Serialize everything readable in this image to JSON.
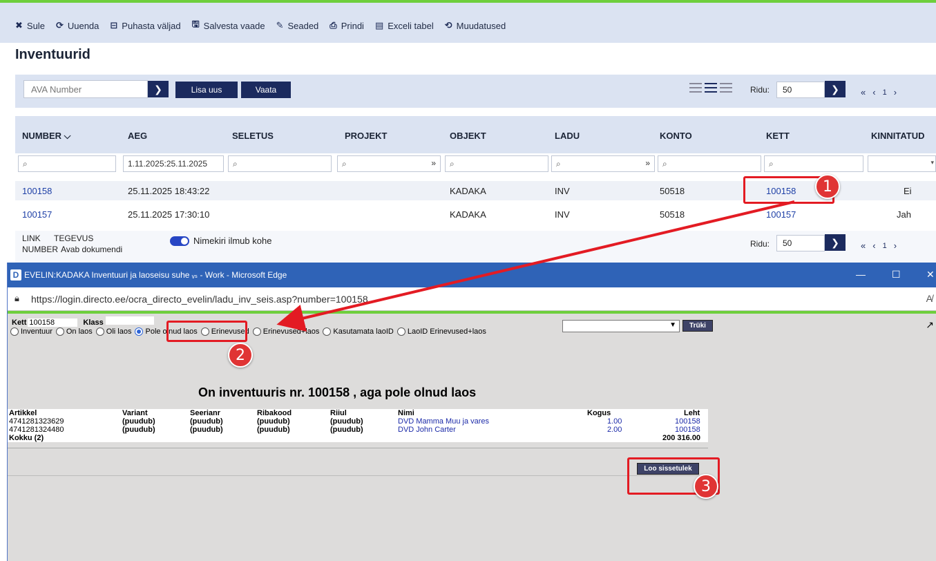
{
  "toolbar": {
    "items": [
      {
        "icon": "✖",
        "label": "Sule"
      },
      {
        "icon": "⟳",
        "label": "Uuenda"
      },
      {
        "icon": "⊟",
        "label": "Puhasta väljad"
      },
      {
        "icon": "🖫",
        "label": "Salvesta vaade"
      },
      {
        "icon": "✎",
        "label": "Seaded"
      },
      {
        "icon": "⎙",
        "label": "Prindi"
      },
      {
        "icon": "▤",
        "label": "Exceli tabel"
      },
      {
        "icon": "⟲",
        "label": "Muudatused"
      }
    ]
  },
  "page": {
    "title": "Inventuurid"
  },
  "actions": {
    "ava_placeholder": "AVA Number",
    "lisa_uus": "Lisa uus",
    "vaata": "Vaata",
    "ridu_label": "Ridu:",
    "ridu_value": "50",
    "page_number": "1"
  },
  "grid": {
    "columns": [
      "NUMBER ⌵",
      "AEG",
      "SELETUS",
      "PROJEKT",
      "OBJEKT",
      "LADU",
      "KONTO",
      "KETT",
      "KINNITATUD"
    ],
    "date_filter": "1.11.2025:25.11.2025",
    "rows": [
      {
        "number": "100158",
        "aeg": "25.11.2025 18:43:22",
        "objekt": "KADAKA",
        "ladu": "INV",
        "konto": "50518",
        "kett": "100158",
        "kinnitatud": "Ei"
      },
      {
        "number": "100157",
        "aeg": "25.11.2025 17:30:10",
        "objekt": "KADAKA",
        "ladu": "INV",
        "konto": "50518",
        "kett": "100157",
        "kinnitatud": "Jah"
      }
    ]
  },
  "legend": {
    "link": "LINK",
    "tegevus": "TEGEVUS",
    "number": "NUMBER",
    "avab": "Avab dokumendi",
    "toggle_label": "Nimekiri ilmub kohe",
    "ridu_label": "Ridu:",
    "ridu_value": "50",
    "page_number": "1"
  },
  "edge": {
    "title": "EVELIN:KADAKA Inventuuri ja laoseisu suhe ᵥₛ - Work - Microsoft Edge",
    "url": "https://login.directo.ee/ocra_directo_evelin/ladu_inv_seis.asp?number=100158",
    "minimize": "—",
    "maximize": "☐",
    "close": "✕"
  },
  "report": {
    "kett_label": "Kett",
    "kett_value": "100158",
    "klass_label": "Klass",
    "radios": [
      "Inventuur",
      "On laos",
      "Oli laos",
      "Pole olnud laos",
      "Erinevused",
      "Erinevused+laos",
      "Kasutamata laoID",
      "LaoID Erinevused+laos"
    ],
    "selected_radio": "Pole olnud laos",
    "truki": "Trüki",
    "heading": "On inventuuris nr. 100158 , aga pole olnud laos",
    "columns": [
      "Artikkel",
      "Variant",
      "Seerianr",
      "Ribakood",
      "Riiul",
      "Nimi",
      "Kogus",
      "Leht"
    ],
    "rows": [
      {
        "artikkel": "4741281323629",
        "variant": "(puudub)",
        "seerianr": "(puudub)",
        "ribakood": "(puudub)",
        "riiul": "(puudub)",
        "nimi": "DVD Mamma Muu ja vares",
        "kogus": "1.00",
        "leht": "100158"
      },
      {
        "artikkel": "4741281324480",
        "variant": "(puudub)",
        "seerianr": "(puudub)",
        "ribakood": "(puudub)",
        "riiul": "(puudub)",
        "nimi": "DVD John Carter",
        "kogus": "2.00",
        "leht": "100158"
      }
    ],
    "total_label": "Kokku (2)",
    "total_value": "200 316.00",
    "loo_sissetulek": "Loo sissetulek"
  },
  "annotations": [
    "1",
    "2",
    "3"
  ],
  "colors": {
    "navy": "#1b2a5e",
    "header_bg": "#dbe3f2",
    "link": "#1d3fa6",
    "green": "#6ecf3d",
    "edge_blue": "#2f63b7",
    "annotation_red": "#e31b23"
  }
}
